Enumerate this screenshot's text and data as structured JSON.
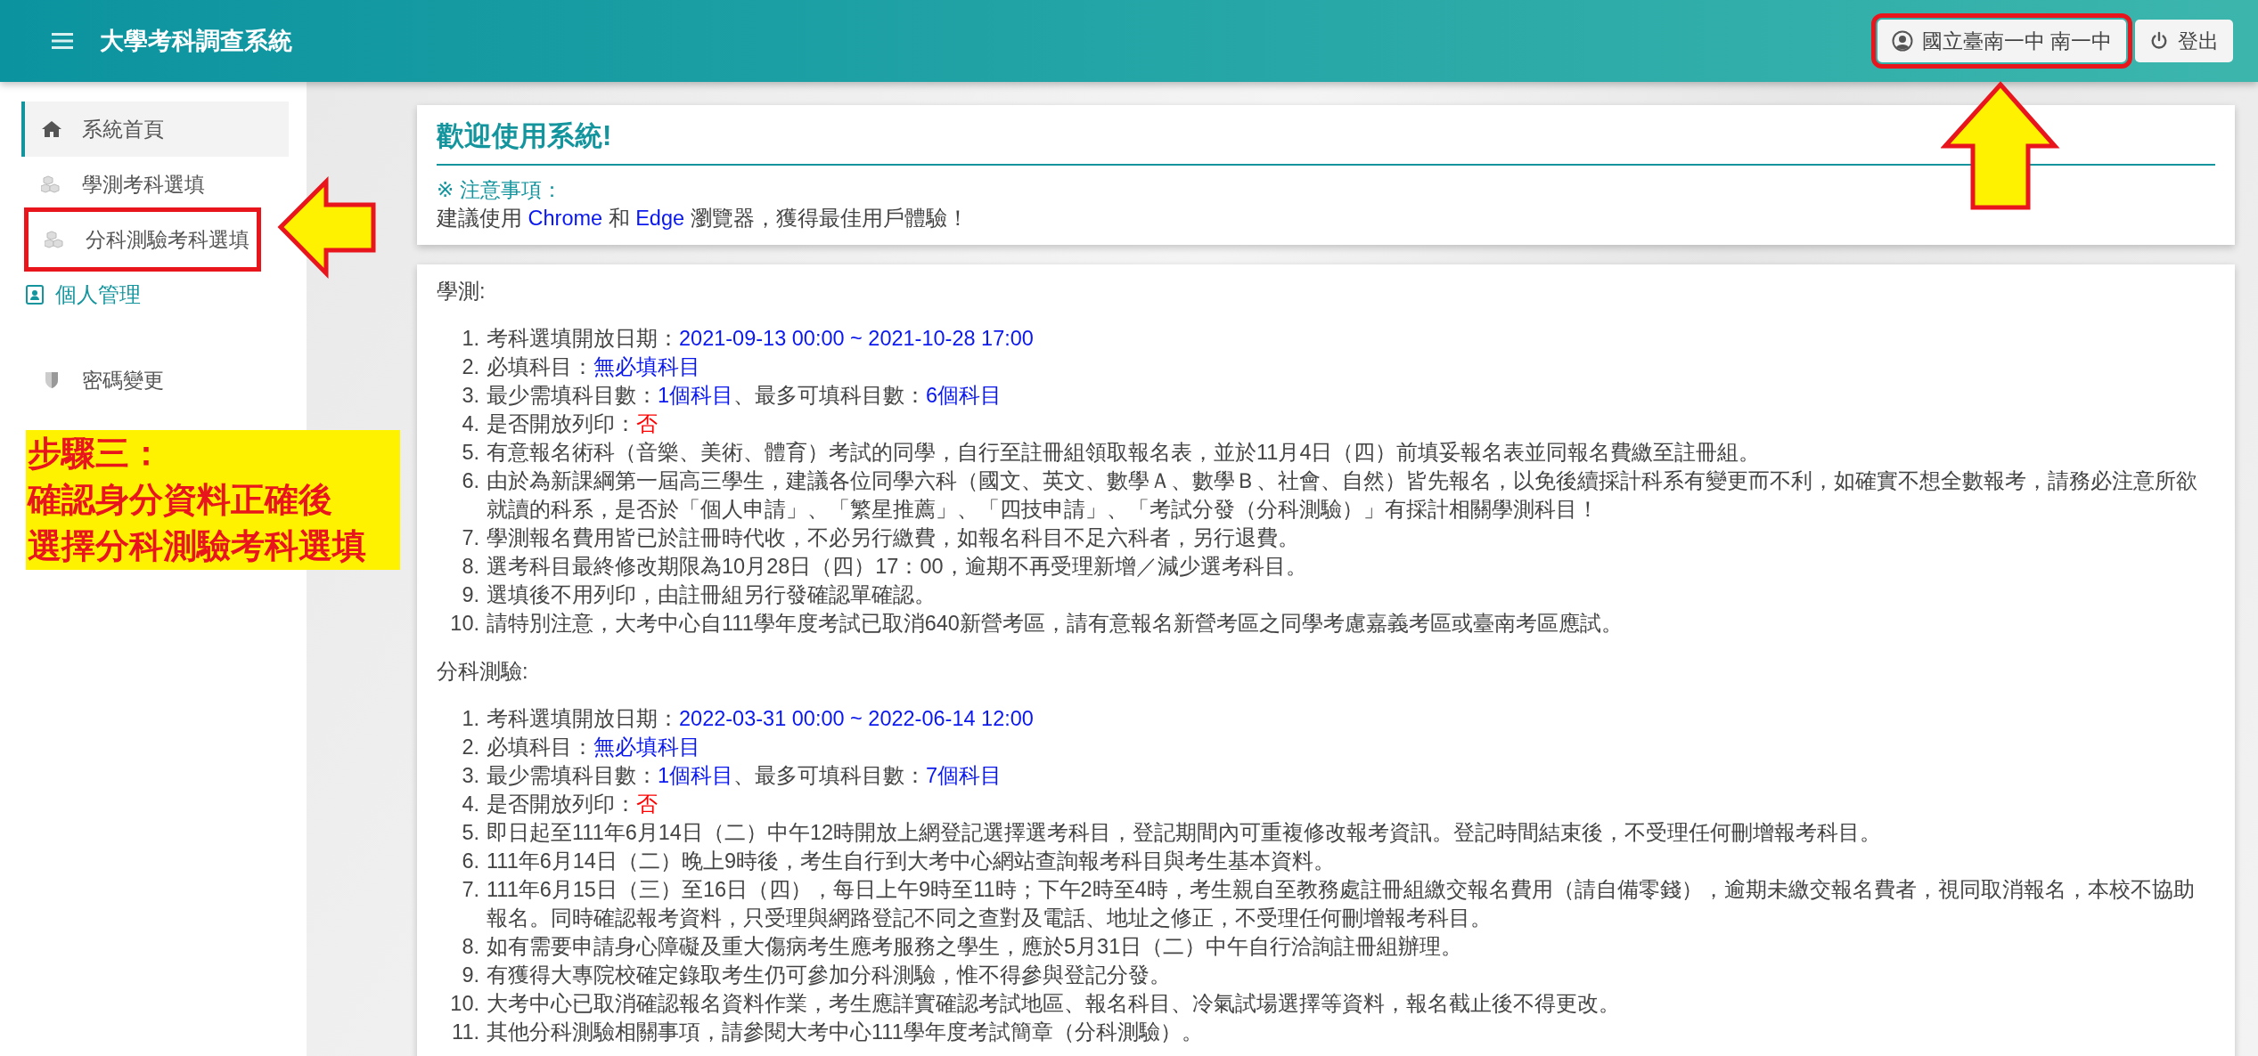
{
  "header": {
    "title": "大學考科調查系統",
    "user_button": {
      "label": "國立臺南一中 南一中",
      "highlighted": true
    },
    "logout_button": {
      "label": "登出"
    }
  },
  "sidebar": {
    "items": [
      {
        "label": "系統首頁",
        "kind": "home",
        "selected": true,
        "highlighted": false
      },
      {
        "label": "學測考科選填",
        "kind": "option",
        "selected": false,
        "highlighted": false
      },
      {
        "label": "分科測驗考科選填",
        "kind": "option",
        "selected": false,
        "highlighted": true
      },
      {
        "label": "個人管理",
        "kind": "section",
        "selected": false,
        "highlighted": false
      },
      {
        "label": "密碼變更",
        "kind": "password",
        "selected": false,
        "highlighted": false
      }
    ]
  },
  "welcome": {
    "title": "歡迎使用系統!",
    "note_heading": "※ 注意事項：",
    "note_text": [
      {
        "t": "建議使用 ",
        "kind": "plain"
      },
      {
        "t": "Chrome",
        "kind": "value"
      },
      {
        "t": " 和 ",
        "kind": "plain"
      },
      {
        "t": "Edge",
        "kind": "value"
      },
      {
        "t": " 瀏覽器，獲得最佳用戶體驗！",
        "kind": "plain"
      }
    ]
  },
  "sections": [
    {
      "heading": "學測:",
      "items": [
        {
          "number": "1.",
          "parts": [
            {
              "t": "考科選填開放日期：",
              "kind": "plain"
            },
            {
              "t": "2021-09-13 00:00 ~ 2021-10-28 17:00",
              "kind": "value"
            }
          ]
        },
        {
          "number": "2.",
          "parts": [
            {
              "t": "必填科目：",
              "kind": "plain"
            },
            {
              "t": "無必填科目",
              "kind": "value"
            }
          ]
        },
        {
          "number": "3.",
          "parts": [
            {
              "t": "最少需填科目數：",
              "kind": "plain"
            },
            {
              "t": "1個科目",
              "kind": "value"
            },
            {
              "t": "、最多可填科目數：",
              "kind": "plain"
            },
            {
              "t": "6個科目",
              "kind": "value"
            }
          ]
        },
        {
          "number": "4.",
          "parts": [
            {
              "t": "是否開放列印：",
              "kind": "plain"
            },
            {
              "t": "否",
              "kind": "warning"
            }
          ]
        },
        {
          "number": "5.",
          "parts": [
            {
              "t": "有意報名術科（音樂、美術、體育）考試的同學，自行至註冊組領取報名表，並於11月4日（四）前填妥報名表並同報名費繳至註冊組。",
              "kind": "plain"
            }
          ]
        },
        {
          "number": "6.",
          "parts": [
            {
              "t": "由於為新課綱第一屆高三學生，建議各位同學六科（國文、英文、數學Ａ、數學Ｂ、社會、自然）皆先報名，以免後續採計科系有變更而不利，如確實不想全數報考，請務必注意所欲就讀的科系，是否於「個人申請」、「繁星推薦」、「四技申請」、「考試分發（分科測驗）」有採計相關學測科目！",
              "kind": "plain"
            }
          ]
        },
        {
          "number": "7.",
          "parts": [
            {
              "t": "學測報名費用皆已於註冊時代收，不必另行繳費，如報名科目不足六科者，另行退費。",
              "kind": "plain"
            }
          ]
        },
        {
          "number": "8.",
          "parts": [
            {
              "t": "選考科目最終修改期限為10月28日（四）17：00，逾期不再受理新增／減少選考科目。",
              "kind": "plain"
            }
          ]
        },
        {
          "number": "9.",
          "parts": [
            {
              "t": "選填後不用列印，由註冊組另行發確認單確認。",
              "kind": "plain"
            }
          ]
        },
        {
          "number": "10.",
          "parts": [
            {
              "t": "請特別注意，大考中心自111學年度考試已取消640新營考區，請有意報名新營考區之同學考慮嘉義考區或臺南考區應試。",
              "kind": "plain"
            }
          ]
        }
      ]
    },
    {
      "heading": "分科測驗:",
      "items": [
        {
          "number": "1.",
          "parts": [
            {
              "t": "考科選填開放日期：",
              "kind": "plain"
            },
            {
              "t": "2022-03-31 00:00 ~ 2022-06-14 12:00",
              "kind": "value"
            }
          ]
        },
        {
          "number": "2.",
          "parts": [
            {
              "t": "必填科目：",
              "kind": "plain"
            },
            {
              "t": "無必填科目",
              "kind": "value"
            }
          ]
        },
        {
          "number": "3.",
          "parts": [
            {
              "t": "最少需填科目數：",
              "kind": "plain"
            },
            {
              "t": "1個科目",
              "kind": "value"
            },
            {
              "t": "、最多可填科目數：",
              "kind": "plain"
            },
            {
              "t": "7個科目",
              "kind": "value"
            }
          ]
        },
        {
          "number": "4.",
          "parts": [
            {
              "t": "是否開放列印：",
              "kind": "plain"
            },
            {
              "t": "否",
              "kind": "warning"
            }
          ]
        },
        {
          "number": "5.",
          "parts": [
            {
              "t": "即日起至111年6月14日（二）中午12時開放上網登記選擇選考科目，登記期間內可重複修改報考資訊。登記時間結束後，不受理任何刪增報考科目。",
              "kind": "plain"
            }
          ]
        },
        {
          "number": "6.",
          "parts": [
            {
              "t": "111年6月14日（二）晚上9時後，考生自行到大考中心網站查詢報考科目與考生基本資料。",
              "kind": "plain"
            }
          ]
        },
        {
          "number": "7.",
          "parts": [
            {
              "t": "111年6月15日（三）至16日（四），每日上午9時至11時；下午2時至4時，考生親自至教務處註冊組繳交報名費用（請自備零錢），逾期未繳交報名費者，視同取消報名，本校不協助報名。同時確認報考資料，只受理與網路登記不同之查對及電話、地址之修正，不受理任何刪增報考科目。",
              "kind": "plain"
            }
          ]
        },
        {
          "number": "8.",
          "parts": [
            {
              "t": "如有需要申請身心障礙及重大傷病考生應考服務之學生，應於5月31日（二）中午自行洽詢註冊組辦理。",
              "kind": "plain"
            }
          ]
        },
        {
          "number": "9.",
          "parts": [
            {
              "t": "有獲得大專院校確定錄取考生仍可參加分科測驗，惟不得參與登記分發。",
              "kind": "plain"
            }
          ]
        },
        {
          "number": "10.",
          "parts": [
            {
              "t": "大考中心已取消確認報名資料作業，考生應詳實確認考試地區、報名科目、冷氣試場選擇等資料，報名截止後不得更改。",
              "kind": "plain"
            }
          ]
        },
        {
          "number": "11.",
          "parts": [
            {
              "t": "其他分科測驗相關事項，請參閱大考中心111學年度考試簡章（分科測驗）。",
              "kind": "plain"
            }
          ]
        }
      ]
    }
  ],
  "annotations": {
    "arrows": [
      {
        "kind": "left"
      },
      {
        "kind": "up"
      }
    ],
    "step_lines": [
      "步驟三：",
      "確認身分資料正確後",
      "選擇分科測驗考科選填"
    ]
  }
}
